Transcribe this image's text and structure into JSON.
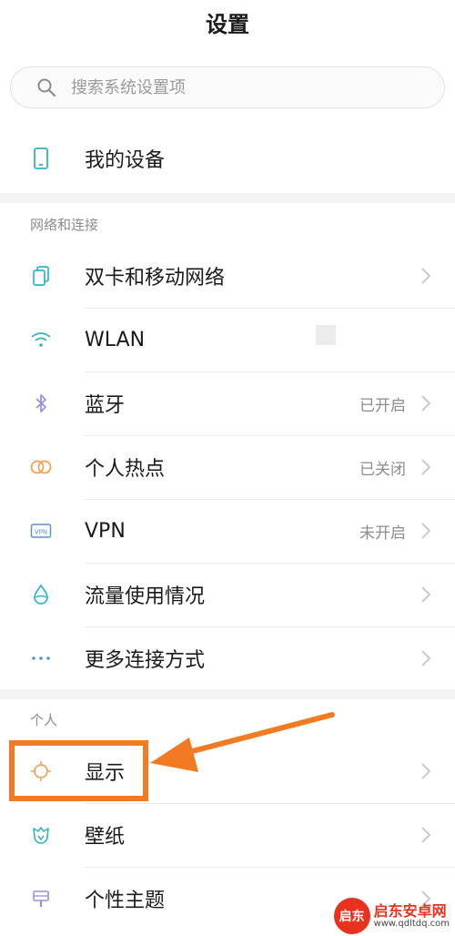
{
  "header": {
    "title": "设置"
  },
  "search": {
    "placeholder": "搜索系统设置项"
  },
  "device": {
    "label": "我的设备"
  },
  "network": {
    "section_label": "网络和连接",
    "items": [
      {
        "label": "双卡和移动网络",
        "status": "",
        "icon": "dual-sim-icon"
      },
      {
        "label": "WLAN",
        "status": "",
        "icon": "wifi-icon"
      },
      {
        "label": "蓝牙",
        "status": "已开启",
        "icon": "bluetooth-icon"
      },
      {
        "label": "个人热点",
        "status": "已关闭",
        "icon": "hotspot-icon"
      },
      {
        "label": "VPN",
        "status": "未开启",
        "icon": "vpn-icon"
      },
      {
        "label": "流量使用情况",
        "status": "",
        "icon": "data-usage-icon"
      },
      {
        "label": "更多连接方式",
        "status": "",
        "icon": "more-dots-icon"
      }
    ]
  },
  "personal": {
    "section_label": "个人",
    "items": [
      {
        "label": "显示",
        "icon": "display-brightness-icon"
      },
      {
        "label": "壁纸",
        "icon": "wallpaper-icon"
      },
      {
        "label": "个性主题",
        "icon": "theme-icon"
      }
    ]
  },
  "watermark": {
    "logo": "启东",
    "title": "启东安卓网",
    "url": "www.qdltdq.com"
  },
  "colors": {
    "highlight": "#f27a22",
    "teal_icon": "#2fb4c4",
    "purple_icon": "#9a8ce0",
    "orange_icon": "#f0a04e",
    "blue_icon": "#5a8fd8",
    "text": "#1a1a1a",
    "secondary_text": "#8c8c8c"
  }
}
